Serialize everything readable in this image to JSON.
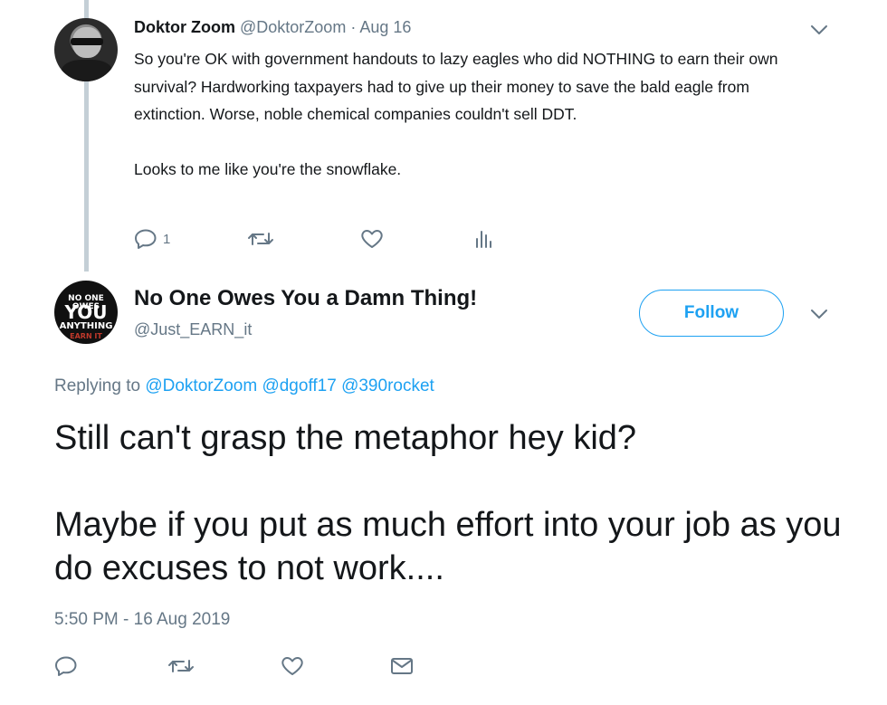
{
  "tweet1": {
    "name": "Doktor Zoom",
    "handle": "@DoktorZoom",
    "date": "Aug 16",
    "paragraph1": "So you're OK with government handouts to lazy eagles who did NOTHING to earn their own survival? Hardworking taxpayers had to give up their money to save the bald eagle from extinction. Worse, noble chemical companies couldn't sell DDT.",
    "paragraph2": "Looks to me like you're the snowflake.",
    "reply_count": "1",
    "avatar_icon": "photo-avatar-icon"
  },
  "tweet2": {
    "name": "No One Owes You a Damn Thing!",
    "handle": "@Just_EARN_it",
    "follow_label": "Follow",
    "replying_prefix": "Replying to",
    "mentions": [
      "@DoktorZoom",
      "@dgoff17",
      "@390rocket"
    ],
    "paragraph1": "Still can't grasp the metaphor hey kid?",
    "paragraph2": "Maybe if you put as much effort into your job as you do excuses to not work....",
    "timestamp": "5:50 PM - 16 Aug 2019",
    "avatar_lines": [
      "NO ONE OWES",
      "YOU",
      "ANYTHING",
      "EARN IT"
    ]
  },
  "icons": {
    "reply": "reply-icon",
    "retweet": "retweet-icon",
    "like": "heart-icon",
    "analytics": "analytics-icon",
    "message": "envelope-icon",
    "caret": "chevron-down-icon"
  },
  "colors": {
    "accent": "#1da1f2",
    "muted": "#657786",
    "text": "#14171a",
    "thread_line": "#c4cfd6"
  }
}
